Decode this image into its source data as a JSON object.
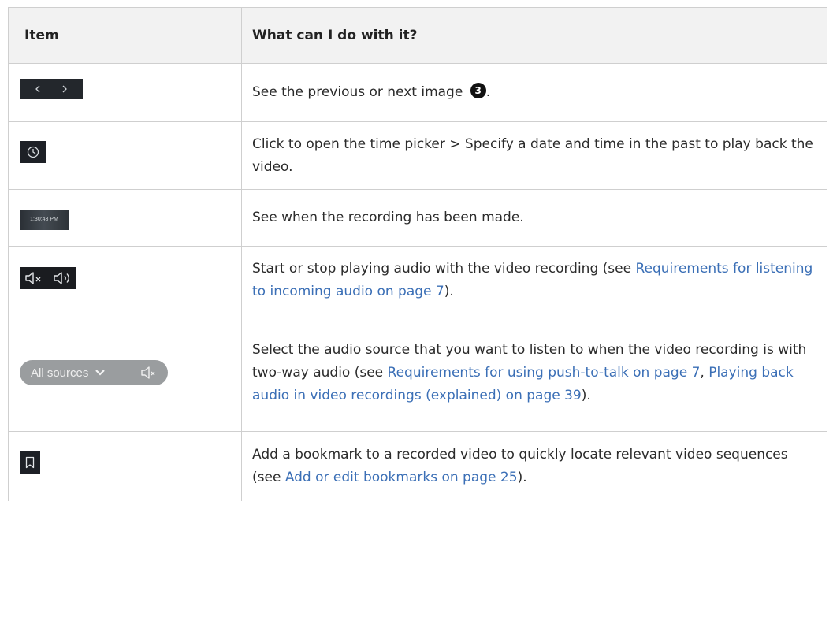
{
  "table": {
    "headers": {
      "item": "Item",
      "description": "What can I do with it?"
    },
    "rows": [
      {
        "icon": "prev-next-icons",
        "text": "See the previous or next image ",
        "badge": "3",
        "after_badge": "."
      },
      {
        "icon": "clock-icon",
        "text": "Click to open the time picker > Specify a date and time in the past to play back the video."
      },
      {
        "icon": "timestamp-thumbnail",
        "timestamp": "1:30:43 PM",
        "text": "See when the recording has been made."
      },
      {
        "icon": "speaker-mute-and-unmute-icons",
        "text_before": "Start or stop playing audio with the video recording (see ",
        "link": "Requirements for listening to incoming audio on page 7",
        "text_after": ")."
      },
      {
        "icon": "audio-source-selector",
        "selector_label": "All sources",
        "text_before": "Select the audio source that you want to listen to when the video recording is with two-way audio (see ",
        "link1": "Requirements for using push-to-talk on page 7",
        "separator": ", ",
        "link2": "Playing back audio in video recordings (explained) on page 39",
        "text_after": ")."
      },
      {
        "icon": "bookmark-icon",
        "text_before": "Add a bookmark to a recorded video to quickly locate relevant video sequences (see ",
        "link": "Add or edit bookmarks on page 25",
        "text_after": ")."
      }
    ]
  },
  "colors": {
    "link": "#3b6fb6",
    "header_bg": "#f2f2f2",
    "border": "#cfcfcf"
  }
}
